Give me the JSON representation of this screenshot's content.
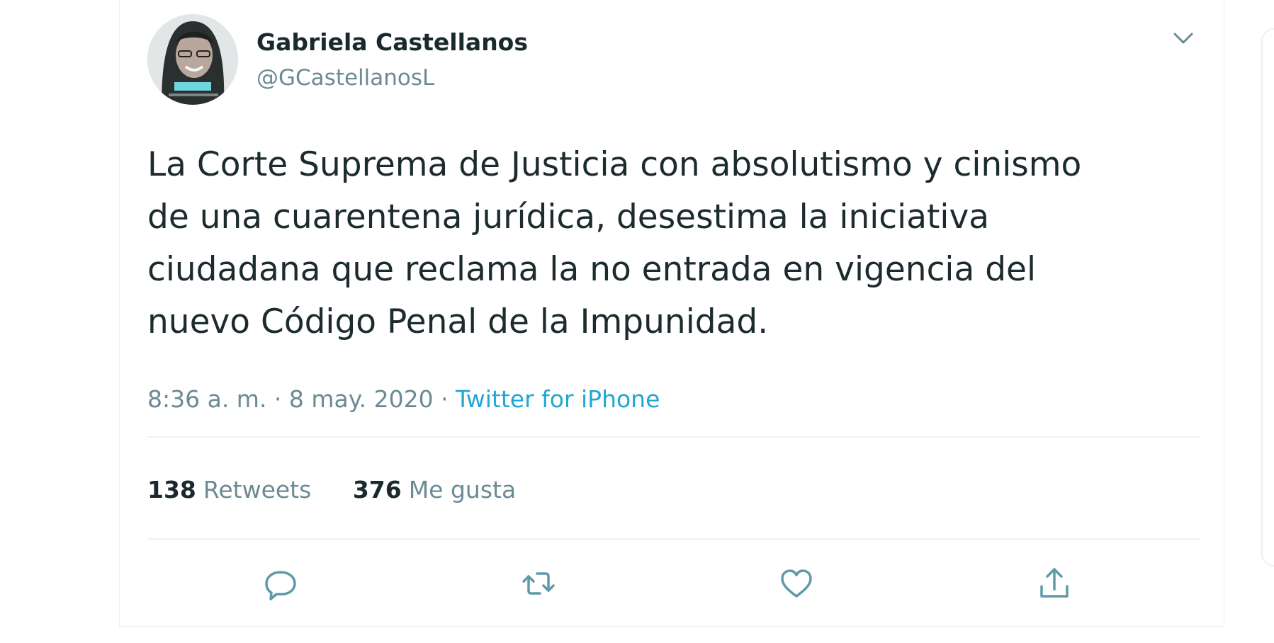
{
  "author": {
    "name": "Gabriela Castellanos",
    "handle": "@GCastellanosL"
  },
  "tweet": {
    "lines": [
      "La Corte Suprema de Justicia con absolutismo y cinismo",
      "de una cuarentena jurídica, desestima la iniciativa",
      "ciudadana que reclama la no entrada en vigencia del",
      "nuevo Código Penal de la Impunidad."
    ]
  },
  "meta": {
    "time": "8:36 a. m.",
    "sep1": " · ",
    "date": "8 may. 2020",
    "sep2": " · ",
    "source": "Twitter for iPhone"
  },
  "stats": {
    "retweets_count": "138",
    "retweets_label": "Retweets",
    "likes_count": "376",
    "likes_label": "Me gusta"
  },
  "icons": {
    "menu": "chevron-down-icon",
    "reply": "reply-icon",
    "retweet": "retweet-icon",
    "like": "heart-icon",
    "share": "share-icon"
  },
  "colors": {
    "accent": "#22a6d4",
    "text": "#1c2b2e",
    "muted": "#6b8a93",
    "icon": "#5f9aa8"
  }
}
